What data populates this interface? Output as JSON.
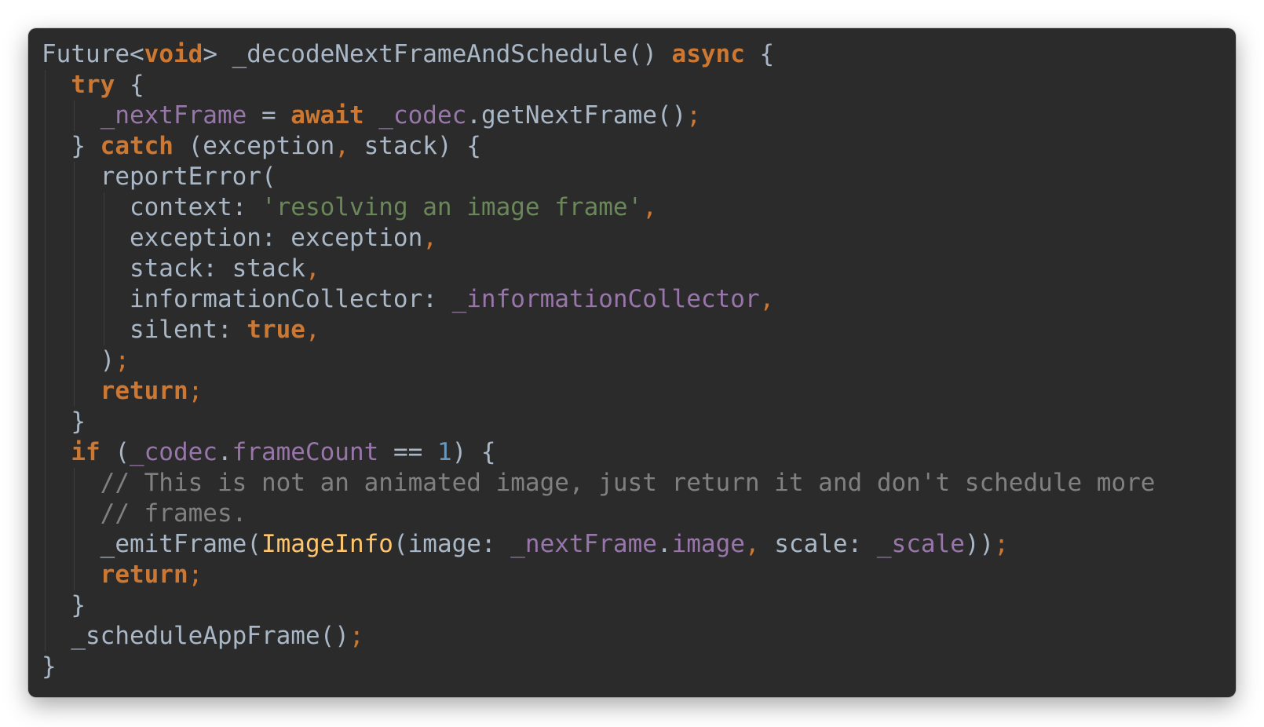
{
  "editor": {
    "lines": [
      {
        "indent": 0,
        "tokens": [
          {
            "text": "Future<",
            "type": "plain"
          },
          {
            "text": "void",
            "type": "kw"
          },
          {
            "text": "> _decodeNextFrameAndSchedule() ",
            "type": "plain"
          },
          {
            "text": "async",
            "type": "kw"
          },
          {
            "text": " {",
            "type": "plain"
          }
        ]
      },
      {
        "indent": 1,
        "tokens": [
          {
            "text": "try",
            "type": "kw"
          },
          {
            "text": " {",
            "type": "plain"
          }
        ]
      },
      {
        "indent": 2,
        "tokens": [
          {
            "text": "_nextFrame",
            "type": "field"
          },
          {
            "text": " = ",
            "type": "plain"
          },
          {
            "text": "await",
            "type": "kw"
          },
          {
            "text": " ",
            "type": "plain"
          },
          {
            "text": "_codec",
            "type": "field"
          },
          {
            "text": ".getNextFrame()",
            "type": "plain"
          },
          {
            "text": ";",
            "type": "punct"
          }
        ]
      },
      {
        "indent": 1,
        "tokens": [
          {
            "text": "} ",
            "type": "plain"
          },
          {
            "text": "catch",
            "type": "kw"
          },
          {
            "text": " (exception",
            "type": "plain"
          },
          {
            "text": ",",
            "type": "punct"
          },
          {
            "text": " stack) {",
            "type": "plain"
          }
        ]
      },
      {
        "indent": 2,
        "tokens": [
          {
            "text": "reportError(",
            "type": "plain"
          }
        ]
      },
      {
        "indent": 3,
        "tokens": [
          {
            "text": "context: ",
            "type": "plain"
          },
          {
            "text": "'resolving an image frame'",
            "type": "str"
          },
          {
            "text": ",",
            "type": "punct"
          }
        ]
      },
      {
        "indent": 3,
        "tokens": [
          {
            "text": "exception: exception",
            "type": "plain"
          },
          {
            "text": ",",
            "type": "punct"
          }
        ]
      },
      {
        "indent": 3,
        "tokens": [
          {
            "text": "stack: stack",
            "type": "plain"
          },
          {
            "text": ",",
            "type": "punct"
          }
        ]
      },
      {
        "indent": 3,
        "tokens": [
          {
            "text": "informationCollector: ",
            "type": "plain"
          },
          {
            "text": "_informationCollector",
            "type": "field"
          },
          {
            "text": ",",
            "type": "punct"
          }
        ]
      },
      {
        "indent": 3,
        "tokens": [
          {
            "text": "silent: ",
            "type": "plain"
          },
          {
            "text": "true",
            "type": "kw"
          },
          {
            "text": ",",
            "type": "punct"
          }
        ]
      },
      {
        "indent": 2,
        "tokens": [
          {
            "text": ")",
            "type": "plain"
          },
          {
            "text": ";",
            "type": "punct"
          }
        ]
      },
      {
        "indent": 2,
        "tokens": [
          {
            "text": "return",
            "type": "kw"
          },
          {
            "text": ";",
            "type": "punct"
          }
        ]
      },
      {
        "indent": 1,
        "tokens": [
          {
            "text": "}",
            "type": "plain"
          }
        ]
      },
      {
        "indent": 1,
        "tokens": [
          {
            "text": "if",
            "type": "kw"
          },
          {
            "text": " (",
            "type": "plain"
          },
          {
            "text": "_codec",
            "type": "field"
          },
          {
            "text": ".",
            "type": "plain"
          },
          {
            "text": "frameCount",
            "type": "field"
          },
          {
            "text": " == ",
            "type": "plain"
          },
          {
            "text": "1",
            "type": "num"
          },
          {
            "text": ") {",
            "type": "plain"
          }
        ]
      },
      {
        "indent": 2,
        "tokens": [
          {
            "text": "// This is not an animated image, just return it and don't schedule more",
            "type": "com"
          }
        ]
      },
      {
        "indent": 2,
        "tokens": [
          {
            "text": "// frames.",
            "type": "com"
          }
        ]
      },
      {
        "indent": 2,
        "tokens": [
          {
            "text": "_emitFrame(",
            "type": "plain"
          },
          {
            "text": "ImageInfo",
            "type": "cls"
          },
          {
            "text": "(image: ",
            "type": "plain"
          },
          {
            "text": "_nextFrame",
            "type": "field"
          },
          {
            "text": ".",
            "type": "plain"
          },
          {
            "text": "image",
            "type": "field"
          },
          {
            "text": ",",
            "type": "punct"
          },
          {
            "text": " scale: ",
            "type": "plain"
          },
          {
            "text": "_scale",
            "type": "field"
          },
          {
            "text": "))",
            "type": "plain"
          },
          {
            "text": ";",
            "type": "punct"
          }
        ]
      },
      {
        "indent": 2,
        "tokens": [
          {
            "text": "return",
            "type": "kw"
          },
          {
            "text": ";",
            "type": "punct"
          }
        ]
      },
      {
        "indent": 1,
        "tokens": [
          {
            "text": "}",
            "type": "plain"
          }
        ]
      },
      {
        "indent": 1,
        "tokens": [
          {
            "text": "_scheduleAppFrame()",
            "type": "plain"
          },
          {
            "text": ";",
            "type": "punct"
          }
        ]
      },
      {
        "indent": 0,
        "tokens": [
          {
            "text": "}",
            "type": "plain"
          }
        ]
      }
    ]
  },
  "colors": {
    "background": "#2b2b2b",
    "keyword": "#cc7832",
    "field": "#9876aa",
    "string": "#6a8759",
    "number": "#6897bb",
    "comment": "#808080",
    "class": "#ffc66d",
    "plain": "#a9b7c6"
  }
}
